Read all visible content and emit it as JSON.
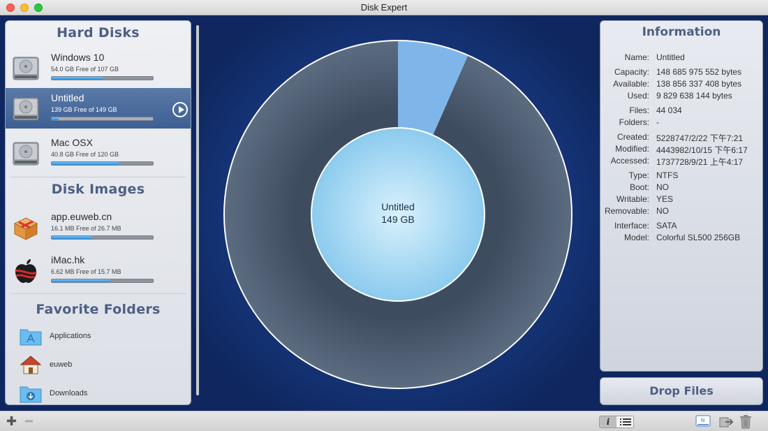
{
  "window": {
    "title": "Disk Expert"
  },
  "sidebar": {
    "hard_disks_title": "Hard Disks",
    "disk_images_title": "Disk Images",
    "favorite_folders_title": "Favorite Folders",
    "hard_disks": [
      {
        "name": "Windows 10",
        "free": "54.0 GB Free of 107 GB",
        "used_fraction": 0.5
      },
      {
        "name": "Untitled",
        "free": "139 GB Free of 149 GB",
        "used_fraction": 0.07
      },
      {
        "name": "Mac OSX",
        "free": "40.8 GB Free of 120 GB",
        "used_fraction": 0.66
      }
    ],
    "disk_images": [
      {
        "name": "app.euweb.cn",
        "free": "16.1 MB Free of 26.7 MB",
        "used_fraction": 0.4
      },
      {
        "name": "iMac.hk",
        "free": "6.62 MB Free of 15.7 MB",
        "used_fraction": 0.58
      }
    ],
    "favorite_folders": [
      {
        "label": "Applications",
        "icon": "applications-folder-icon"
      },
      {
        "label": "euweb",
        "icon": "home-folder-icon"
      },
      {
        "label": "Downloads",
        "icon": "downloads-folder-icon"
      }
    ]
  },
  "chart": {
    "center_name": "Untitled",
    "center_size": "149 GB",
    "used_fraction": 0.066,
    "used_color": "#7fb6ea",
    "free_color": "#4a586a",
    "center_color": "#a9dbf4"
  },
  "info": {
    "title": "Information",
    "rows": [
      {
        "key": "Name:",
        "value": "Untitled"
      },
      {
        "key": "Capacity:",
        "value": "148 685 975 552 bytes"
      },
      {
        "key": "Available:",
        "value": "138 856 337 408 bytes"
      },
      {
        "key": "Used:",
        "value": "9 829 638 144 bytes"
      },
      {
        "key": "Files:",
        "value": "44 034"
      },
      {
        "key": "Folders:",
        "value": "-"
      },
      {
        "key": "Created:",
        "value": "5228747/2/22 下午7:21"
      },
      {
        "key": "Modified:",
        "value": "4443982/10/15 下午6:17"
      },
      {
        "key": "Accessed:",
        "value": "1737728/9/21 上午4:17"
      },
      {
        "key": "Type:",
        "value": "NTFS"
      },
      {
        "key": "Boot:",
        "value": "NO"
      },
      {
        "key": "Writable:",
        "value": "YES"
      },
      {
        "key": "Removable:",
        "value": "NO"
      },
      {
        "key": "Interface:",
        "value": "SATA"
      },
      {
        "key": "Model:",
        "value": "Colorful SL500 256GB"
      }
    ]
  },
  "drop": {
    "label": "Drop Files"
  },
  "toolbar": {
    "info_label": "i"
  }
}
